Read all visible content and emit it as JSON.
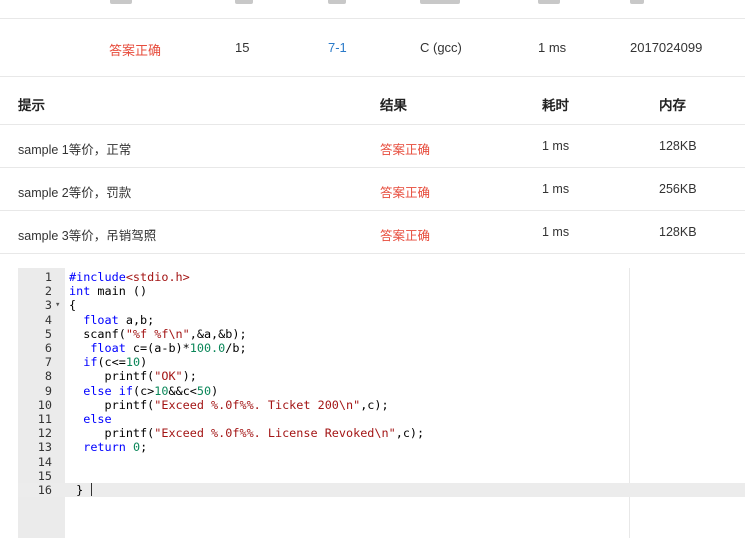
{
  "submission": {
    "status": "答案正确",
    "score": "15",
    "problem": "7-1",
    "compiler": "C (gcc)",
    "time": "1 ms",
    "user": "2017024099"
  },
  "cases": {
    "headers": [
      "提示",
      "结果",
      "耗时",
      "内存"
    ],
    "rows": [
      {
        "hint": "sample 1等价，正常",
        "result": "答案正确",
        "time": "1 ms",
        "memory": "128KB"
      },
      {
        "hint": "sample 2等价，罚款",
        "result": "答案正确",
        "time": "1 ms",
        "memory": "256KB"
      },
      {
        "hint": "sample 3等价，吊销驾照",
        "result": "答案正确",
        "time": "1 ms",
        "memory": "128KB"
      }
    ]
  },
  "code": {
    "lines": [
      "#include<stdio.h>",
      "int main ()",
      "{",
      "  float a,b;",
      "  scanf(\"%f %f\\n\",&a,&b);",
      "   float c=(a-b)*100.0/b;",
      "  if(c<=10)",
      "     printf(\"OK\");",
      "  else if(c>10&&c<50)",
      "     printf(\"Exceed %.0f%%. Ticket 200\\n\",c);",
      "  else",
      "     printf(\"Exceed %.0f%%. License Revoked\\n\",c);",
      "  return 0;",
      "",
      "",
      " }"
    ],
    "active_line": 16,
    "fold_line": 3
  },
  "colors": {
    "accepted": "#e74c3c",
    "link": "#2a7ac9",
    "gutter": "#ebebeb",
    "border": "#e8e8e8"
  }
}
